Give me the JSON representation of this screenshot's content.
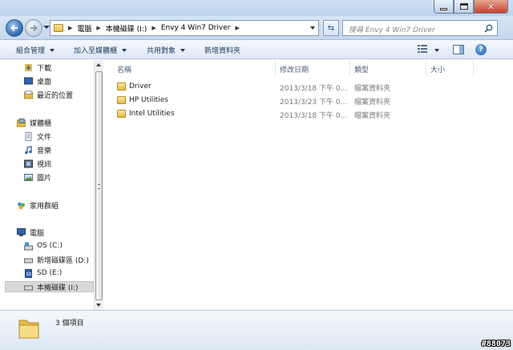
{
  "address": {
    "crumbs": [
      "電腦",
      "本機磁碟 (I:)",
      "Envy 4 Win7 Driver"
    ]
  },
  "search": {
    "placeholder": "搜尋 Envy 4 Win7 Driver"
  },
  "toolbar": {
    "organize": "組合管理",
    "include_library": "加入至媒體櫃",
    "share": "共用對象",
    "new_folder": "新增資料夾"
  },
  "nav": {
    "favorites": [
      "下載",
      "桌面",
      "最近的位置"
    ],
    "libraries_label": "媒體櫃",
    "libraries": [
      "文件",
      "音樂",
      "視訊",
      "圖片"
    ],
    "homegroup": "家用群組",
    "computer_label": "電腦",
    "drives": [
      "OS (C:)",
      "新增磁碟區 (D:)",
      "SD (E:)",
      "本機磁碟 (I:)"
    ]
  },
  "columns": {
    "name": "名稱",
    "date": "修改日期",
    "type": "類型",
    "size": "大小"
  },
  "files": [
    {
      "name": "Driver",
      "date": "2013/3/18 下午 0...",
      "type": "檔案資料夾"
    },
    {
      "name": "HP Utilities",
      "date": "2013/3/23 下午 0...",
      "type": "檔案資料夾"
    },
    {
      "name": "Intel Utilities",
      "date": "2013/3/18 下午 0...",
      "type": "檔案資料夾"
    }
  ],
  "status": {
    "item_count": "3 個項目"
  },
  "watermark": "#88073",
  "colors": {
    "accent": "#2d64ad",
    "selected": "#d9d9d9",
    "folder": "#e4bd4a"
  }
}
